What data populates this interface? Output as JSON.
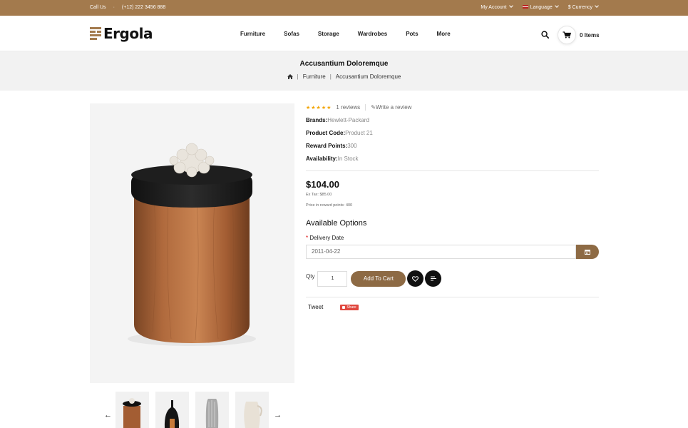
{
  "topbar": {
    "call_label": "Call Us",
    "phone": "(+12) 222 3456 888",
    "account": "My Account",
    "language": "Language",
    "currency": "$ Currency"
  },
  "header": {
    "logo": "Ergola",
    "nav": [
      "Furniture",
      "Sofas",
      "Storage",
      "Wardrobes",
      "Pots",
      "More"
    ],
    "cart_count": "0 Items"
  },
  "page": {
    "title": "Accusantium Doloremque",
    "breadcrumb": [
      "Furniture",
      "Accusantium Doloremque"
    ]
  },
  "product": {
    "reviews": "1 reviews",
    "write_review": "Write a review",
    "rating": 5,
    "brand_label": "Brands:",
    "brand": "Hewlett-Packard",
    "code_label": "Product Code:",
    "code": "Product 21",
    "points_label": "Reward Points:",
    "points": "300",
    "avail_label": "Availability:",
    "availability": "In Stock",
    "price": "$104.00",
    "ex_tax": "Ex Tax: $85.00",
    "reward_price": "Price in reward points: 400",
    "options_title": "Available Options",
    "delivery_label": "Delivery Date",
    "delivery_value": "2011-04-22",
    "qty_label": "Qty",
    "qty_value": "1",
    "add_to_cart": "Add To Cart",
    "tweet": "Tweet",
    "share": "Share"
  },
  "thumbnails": [
    "jar-thumbnail",
    "black-vase-thumbnail",
    "grey-vase-thumbnail",
    "white-jug-thumbnail"
  ],
  "colors": {
    "brand": "#a37a4d",
    "button": "#8d6a44",
    "star": "#f2a400"
  }
}
